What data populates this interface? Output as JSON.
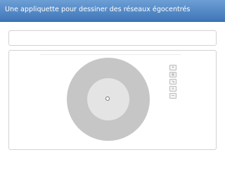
{
  "header": {
    "title": "Une appliquette pour dessiner des réseaux égocentrés"
  },
  "toolbar": {
    "tools": [
      {
        "icon": "add-node-icon",
        "glyph": "•"
      },
      {
        "icon": "ego-node-icon",
        "glyph": "◎"
      },
      {
        "icon": "add-edge-icon",
        "glyph": "↘"
      },
      {
        "icon": "zoom-icon",
        "glyph": "⌕"
      },
      {
        "icon": "clear-icon",
        "glyph": "—"
      }
    ]
  },
  "colors": {
    "title_bar": "#4f86c6",
    "outer_ring": "#c6c6c6",
    "inner_disc": "#e4e4e4",
    "panel_border": "#d2d2d2"
  }
}
